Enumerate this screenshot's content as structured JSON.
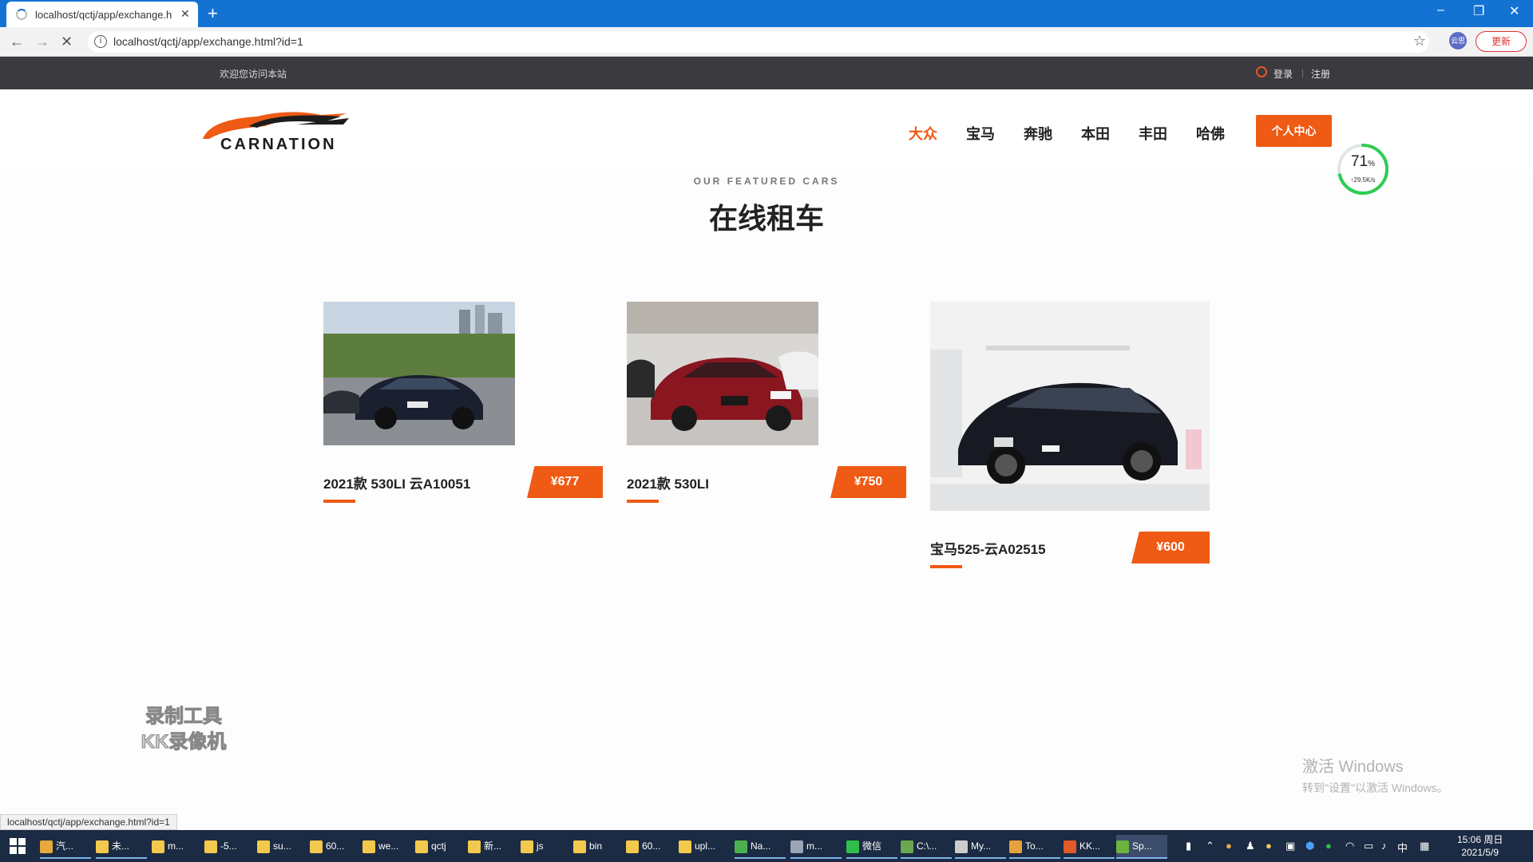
{
  "browser": {
    "tab_title": "localhost/qctj/app/exchange.h",
    "tab_close": "✕",
    "new_tab": "+",
    "url": "localhost/qctj/app/exchange.html?id=1",
    "profile_label": "云思",
    "update_label": "更新",
    "win_minimize": "–",
    "win_restore": "❐",
    "win_close": "✕"
  },
  "topbar": {
    "welcome": "欢迎您访问本站",
    "login": "登录",
    "separator": "|",
    "register": "注册"
  },
  "header": {
    "logo_text": "CARNATION",
    "nav": [
      {
        "label": "大众",
        "active": true
      },
      {
        "label": "宝马",
        "active": false
      },
      {
        "label": "奔驰",
        "active": false
      },
      {
        "label": "本田",
        "active": false
      },
      {
        "label": "丰田",
        "active": false
      },
      {
        "label": "哈佛",
        "active": false
      }
    ],
    "personal_center": "个人中心"
  },
  "progress_widget": {
    "percent_text": "71",
    "percent_sign": "%",
    "percent_value": 0.71,
    "speed": "↑29.5K/s"
  },
  "section": {
    "subtitle": "OUR FEATURED CARS",
    "title": "在线租车"
  },
  "cars": [
    {
      "name": "2021款 530LI 云A10051",
      "price": "¥677",
      "image": "dark-bmw-sedan-outdoor"
    },
    {
      "name": "2021款 530LI",
      "price": "¥750",
      "image": "red-bmw-sedan-showroom"
    },
    {
      "name": "宝马525-云A02515",
      "price": "¥600",
      "image": "black-bmw-sedan-white-wall"
    }
  ],
  "watermarks": {
    "recorder_line1": "录制工具",
    "recorder_line2": "KK录像机",
    "activate_title": "激活 Windows",
    "activate_sub": "转到\"设置\"以激活 Windows。"
  },
  "status_url": "localhost/qctj/app/exchange.html?id=1",
  "taskbar": {
    "items": [
      {
        "label": "汽...",
        "color": "#e8a93b",
        "running": true,
        "active": false
      },
      {
        "label": "未...",
        "color": "#f2c94c",
        "running": true,
        "active": false
      },
      {
        "label": "m...",
        "color": "#f2c94c",
        "running": false,
        "active": false
      },
      {
        "label": "-5...",
        "color": "#f2c94c",
        "running": false,
        "active": false
      },
      {
        "label": "su...",
        "color": "#f2c94c",
        "running": false,
        "active": false
      },
      {
        "label": "60...",
        "color": "#f2c94c",
        "running": false,
        "active": false
      },
      {
        "label": "we...",
        "color": "#f2c94c",
        "running": false,
        "active": false
      },
      {
        "label": "qctj",
        "color": "#f2c94c",
        "running": false,
        "active": false
      },
      {
        "label": "新...",
        "color": "#f2c94c",
        "running": false,
        "active": false
      },
      {
        "label": "js",
        "color": "#f2c94c",
        "running": false,
        "active": false
      },
      {
        "label": "bin",
        "color": "#f2c94c",
        "running": false,
        "active": false
      },
      {
        "label": "60...",
        "color": "#f2c94c",
        "running": false,
        "active": false
      },
      {
        "label": "upl...",
        "color": "#f2c94c",
        "running": false,
        "active": false
      },
      {
        "label": "Na...",
        "color": "#4caf50",
        "running": true,
        "active": false
      },
      {
        "label": "m...",
        "color": "#9aa6b5",
        "running": true,
        "active": false
      },
      {
        "label": "微信",
        "color": "#2fbf4a",
        "running": true,
        "active": false
      },
      {
        "label": "C:\\...",
        "color": "#6aa84f",
        "running": true,
        "active": false
      },
      {
        "label": "My...",
        "color": "#cccccc",
        "running": true,
        "active": false
      },
      {
        "label": "To...",
        "color": "#e6a23c",
        "running": true,
        "active": false
      },
      {
        "label": "KK...",
        "color": "#e05a2a",
        "running": true,
        "active": false
      },
      {
        "label": "Sp...",
        "color": "#6db33f",
        "running": true,
        "active": true
      }
    ],
    "ime": "中",
    "time": "15:06 周日",
    "date": "2021/5/9"
  }
}
